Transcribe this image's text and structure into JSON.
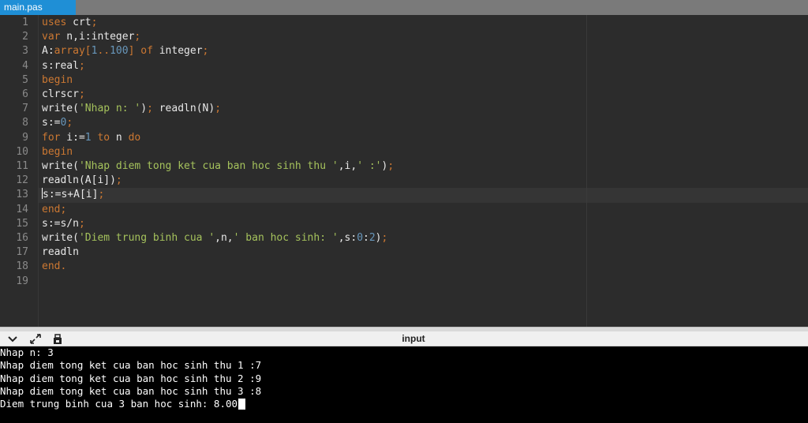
{
  "tab": {
    "label": "main.pas"
  },
  "editor": {
    "line_numbers": [
      "1",
      "2",
      "3",
      "4",
      "5",
      "6",
      "7",
      "8",
      "9",
      "10",
      "11",
      "12",
      "13",
      "14",
      "15",
      "16",
      "17",
      "18",
      "19"
    ],
    "current_line": 13,
    "lines": [
      [
        {
          "t": "uses",
          "c": "kw"
        },
        {
          "t": " crt",
          "c": "id"
        },
        {
          "t": ";",
          "c": "op"
        }
      ],
      [
        {
          "t": "var",
          "c": "kw"
        },
        {
          "t": " n,i:integer",
          "c": "id"
        },
        {
          "t": ";",
          "c": "op"
        }
      ],
      [
        {
          "t": "A:",
          "c": "id"
        },
        {
          "t": "array",
          "c": "kw"
        },
        {
          "t": "[",
          "c": "op"
        },
        {
          "t": "1",
          "c": "num"
        },
        {
          "t": "..",
          "c": "op"
        },
        {
          "t": "100",
          "c": "num"
        },
        {
          "t": "]",
          "c": "op"
        },
        {
          "t": " ",
          "c": "id"
        },
        {
          "t": "of",
          "c": "kw"
        },
        {
          "t": " integer",
          "c": "id"
        },
        {
          "t": ";",
          "c": "op"
        }
      ],
      [
        {
          "t": "s:real",
          "c": "id"
        },
        {
          "t": ";",
          "c": "op"
        }
      ],
      [
        {
          "t": "begin",
          "c": "kw"
        }
      ],
      [
        {
          "t": "clrscr",
          "c": "id"
        },
        {
          "t": ";",
          "c": "op"
        }
      ],
      [
        {
          "t": "write(",
          "c": "id"
        },
        {
          "t": "'Nhap n: '",
          "c": "str"
        },
        {
          "t": ")",
          "c": "id"
        },
        {
          "t": ";",
          "c": "op"
        },
        {
          "t": " readln(N)",
          "c": "id"
        },
        {
          "t": ";",
          "c": "op"
        }
      ],
      [
        {
          "t": "s:=",
          "c": "id"
        },
        {
          "t": "0",
          "c": "num"
        },
        {
          "t": ";",
          "c": "op"
        }
      ],
      [
        {
          "t": "for",
          "c": "kw"
        },
        {
          "t": " i:=",
          "c": "id"
        },
        {
          "t": "1",
          "c": "num"
        },
        {
          "t": " ",
          "c": "id"
        },
        {
          "t": "to",
          "c": "kw"
        },
        {
          "t": " n ",
          "c": "id"
        },
        {
          "t": "do",
          "c": "kw"
        }
      ],
      [
        {
          "t": "begin",
          "c": "kw"
        }
      ],
      [
        {
          "t": "write(",
          "c": "id"
        },
        {
          "t": "'Nhap diem tong ket cua ban hoc sinh thu '",
          "c": "str"
        },
        {
          "t": ",i,",
          "c": "id"
        },
        {
          "t": "' :'",
          "c": "str"
        },
        {
          "t": ")",
          "c": "id"
        },
        {
          "t": ";",
          "c": "op"
        }
      ],
      [
        {
          "t": "readln(A[i])",
          "c": "id"
        },
        {
          "t": ";",
          "c": "op"
        }
      ],
      [
        {
          "t": "s:=s+A[i]",
          "c": "id"
        },
        {
          "t": ";",
          "c": "op"
        }
      ],
      [
        {
          "t": "end",
          "c": "kw"
        },
        {
          "t": ";",
          "c": "op"
        }
      ],
      [
        {
          "t": "s:=s/n",
          "c": "id"
        },
        {
          "t": ";",
          "c": "op"
        }
      ],
      [
        {
          "t": "write(",
          "c": "id"
        },
        {
          "t": "'Diem trung binh cua '",
          "c": "str"
        },
        {
          "t": ",n,",
          "c": "id"
        },
        {
          "t": "' ban hoc sinh: '",
          "c": "str"
        },
        {
          "t": ",s:",
          "c": "id"
        },
        {
          "t": "0",
          "c": "num"
        },
        {
          "t": ":",
          "c": "id"
        },
        {
          "t": "2",
          "c": "num"
        },
        {
          "t": ")",
          "c": "id"
        },
        {
          "t": ";",
          "c": "op"
        }
      ],
      [
        {
          "t": "readln",
          "c": "id"
        }
      ],
      [
        {
          "t": "end",
          "c": "kw"
        },
        {
          "t": ".",
          "c": "op"
        }
      ],
      []
    ]
  },
  "panel": {
    "title": "input",
    "icons": [
      "chevron-down-icon",
      "expand-icon",
      "clear-console-icon"
    ]
  },
  "console": {
    "lines": [
      "Nhap n: 3",
      "Nhap diem tong ket cua ban hoc sinh thu 1 :7",
      "Nhap diem tong ket cua ban hoc sinh thu 2 :9",
      "Nhap diem tong ket cua ban hoc sinh thu 3 :8",
      "Diem trung binh cua 3 ban hoc sinh: 8.00"
    ]
  },
  "colors": {
    "keyword": "#cc7832",
    "string": "#a5c25c",
    "number": "#6897bb",
    "tab_active": "#1f8fd6"
  }
}
